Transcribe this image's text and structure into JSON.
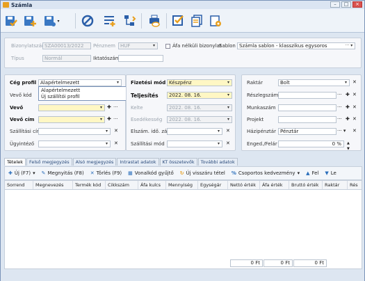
{
  "window": {
    "title": "Számla"
  },
  "header": {
    "bizonylatszam_label": "Bizonylatszám",
    "bizonylatszam_value": "SZA00013/2022",
    "penznem_label": "Pénznem",
    "penznem_value": "HUF",
    "afa_nelkuli_label": "Áfa nélküli bizonylat",
    "sablon_label": "Sablon",
    "sablon_value": "Számla sablon - klasszikus egysoros",
    "tipus_label": "Típus",
    "tipus_value": "Normál",
    "iktatoszam_label": "Iktatószám",
    "iktatoszam_value": ""
  },
  "left_panel": {
    "ceg_profil_label": "Cég profil",
    "ceg_profil_value": "Alapértelmezett",
    "vevo_kod_label": "Vevő kód",
    "vevo_label": "Vevő",
    "vevo_cim_label": "Vevő cím",
    "szallitasi_cim_label": "Szállítási cím",
    "ugyintezo_label": "Ügyintéző",
    "dropdown_options": [
      "Alapértelmezett",
      "Új szállítói profil"
    ]
  },
  "mid_panel": {
    "fizetesi_mod_label": "Fizetési mód",
    "fizetesi_mod_value": "Készpénz",
    "teljesites_label": "Teljesítés",
    "teljesites_value": "2022. 08. 16.",
    "kelte_label": "Kelte",
    "kelte_value": "2022. 08. 16.",
    "esedekesseg_label": "Esedékesség",
    "esedekesseg_value": "2022. 08. 16.",
    "elszam_label": "Elszám. idő. záró",
    "szallitasi_mod_label": "Szállítási mód"
  },
  "right_panel": {
    "raktar_label": "Raktár",
    "raktar_value": "Bolt",
    "reszlegszam_label": "Részlegszám",
    "munkaszam_label": "Munkaszám",
    "projekt_label": "Projekt",
    "hazipenztar_label": "Házipénztár",
    "hazipenztar_value": "Pénztár",
    "enged_label": "Enged./Felár",
    "enged_value": "0 %"
  },
  "tabs": [
    "Tételek",
    "Felső megjegyzés",
    "Alsó megjegyzés",
    "Intrastat adatok",
    "KT összetevők",
    "További adatok"
  ],
  "grid_toolbar": {
    "new": "Új (F7)",
    "open": "Megnyitás (F8)",
    "delete": "Törlés (F9)",
    "barcode": "Vonalkód gyűjtő",
    "return": "Új visszáru tétel",
    "group_discount": "Csoportos kedvezmény",
    "up": "Fel",
    "down": "Le"
  },
  "grid_columns": [
    "Sorrend",
    "Megnevezés",
    "Termék kód",
    "Cikkszám",
    "Áfa kulcs",
    "Mennyiség",
    "Egységár",
    "Nettó érték",
    "Áfa érték",
    "Bruttó érték",
    "Raktár",
    "Rés"
  ],
  "totals": [
    "0 Ft",
    "0 Ft",
    "0 Ft"
  ],
  "colors": {
    "accent": "#2a6ebb",
    "required_bg": "#fff7c4",
    "window_bg": "#dde6f1"
  }
}
